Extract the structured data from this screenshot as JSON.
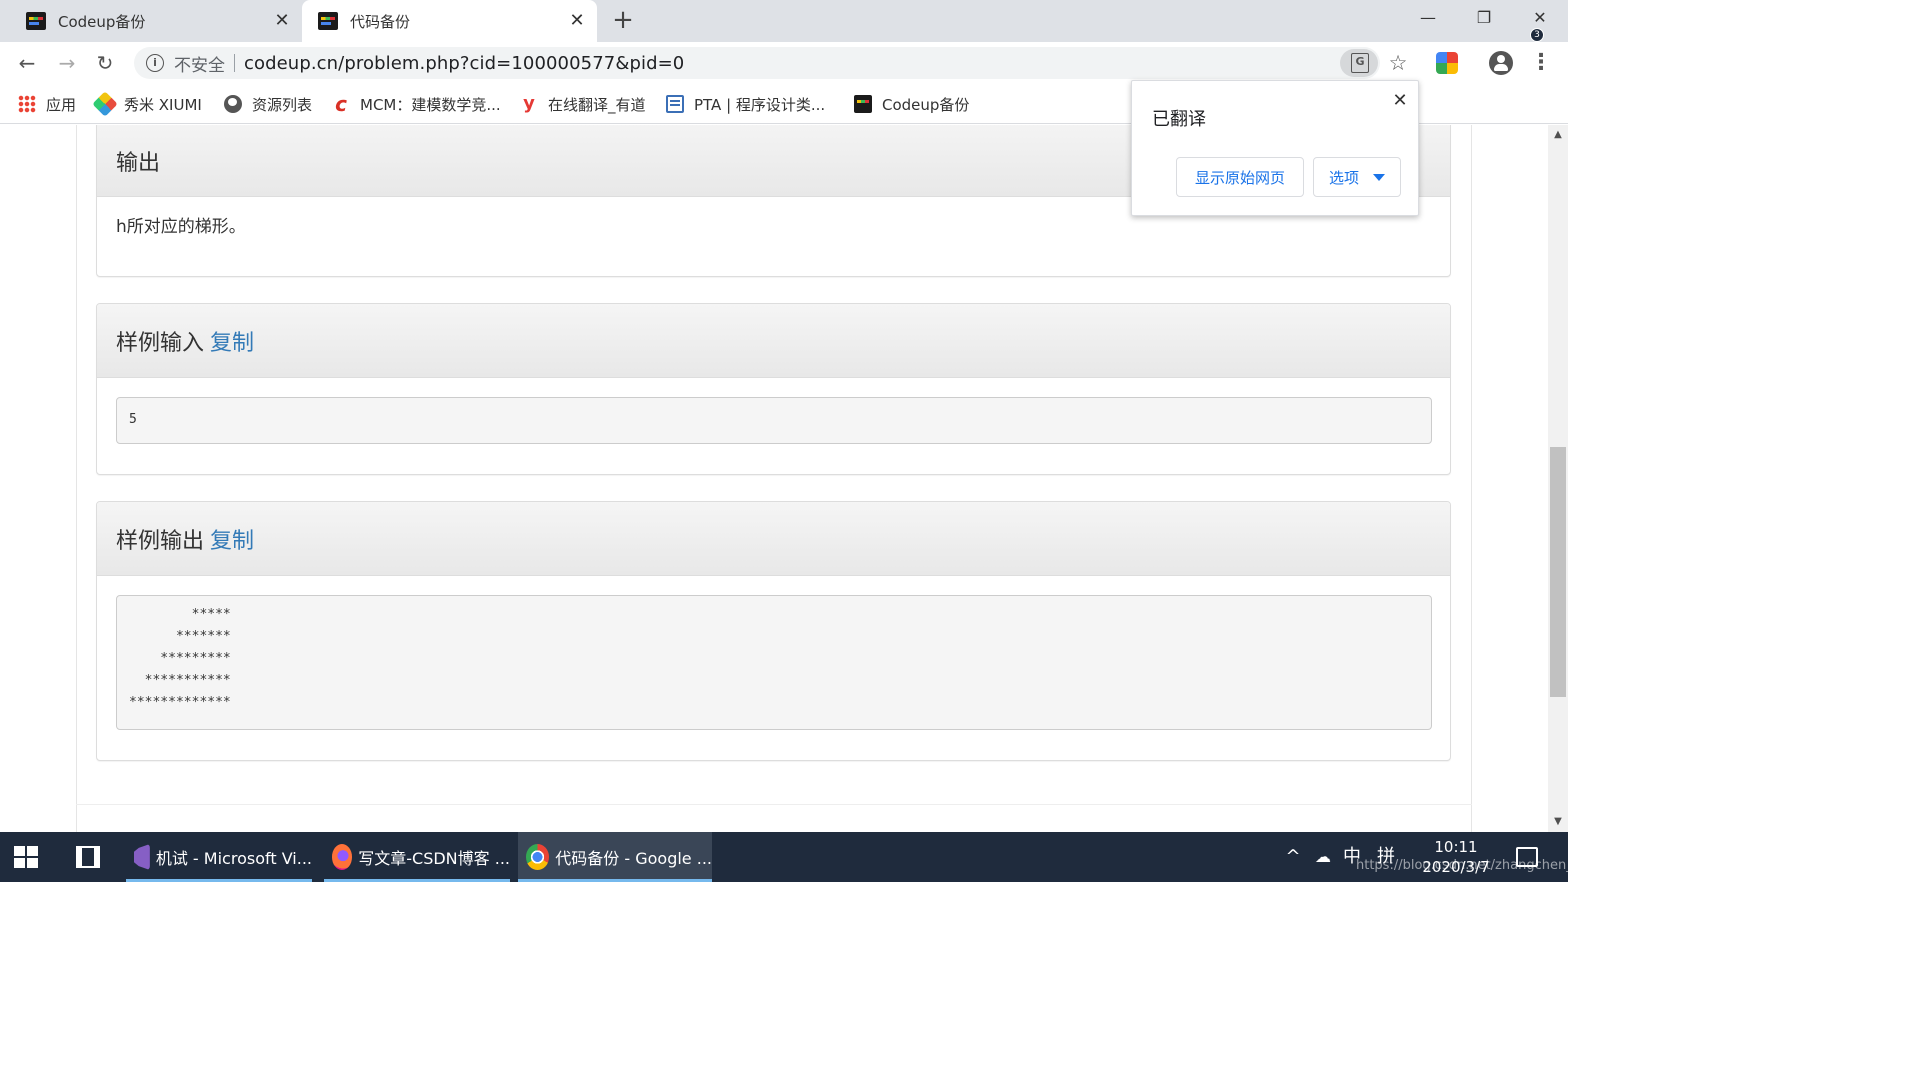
{
  "browser": {
    "tabs": [
      {
        "title": "Codeup备份",
        "close": "✕"
      },
      {
        "title": "代码备份",
        "close": "✕"
      }
    ],
    "new_tab": "+",
    "window_controls": {
      "minimize": "—",
      "restore": "❐",
      "close": "✕"
    },
    "nav": {
      "back": "←",
      "forward": "→",
      "reload": "↻"
    },
    "address": {
      "security_label": "不安全",
      "url": "codeup.cn/problem.php?cid=100000577&pid=0"
    },
    "bookmarks": [
      {
        "label": "应用",
        "icon": "apps-grid-icon"
      },
      {
        "label": "秀米 XIUMI",
        "icon": "xiumi-icon"
      },
      {
        "label": "资源列表",
        "icon": "globe-icon"
      },
      {
        "label": "MCM：建模数学竞...",
        "icon": "mcm-icon"
      },
      {
        "label": "在线翻译_有道",
        "icon": "youdao-icon"
      },
      {
        "label": "PTA | 程序设计类...",
        "icon": "pta-icon"
      },
      {
        "label": "Codeup备份",
        "icon": "codeup-icon"
      }
    ]
  },
  "translate_popup": {
    "title": "已翻译",
    "close": "✕",
    "show_original": "显示原始网页",
    "options": "选项"
  },
  "sections": {
    "output": {
      "heading": "输出",
      "body": "h所对应的梯形。"
    },
    "sample_input": {
      "heading": "样例输入",
      "copy": "复制",
      "content": "5"
    },
    "sample_output": {
      "heading": "样例输出",
      "copy": "复制",
      "content": "        *****\n      *******\n    *********\n  ***********\n*************"
    }
  },
  "scrollbar": {
    "up": "▲",
    "down": "▼"
  },
  "taskbar": {
    "items": [
      {
        "label": "机试 - Microsoft Vi...",
        "icon": "visual-studio-icon"
      },
      {
        "label": "写文章-CSDN博客 ...",
        "icon": "firefox-icon"
      },
      {
        "label": "代码备份 - Google ...",
        "icon": "chrome-icon"
      }
    ],
    "tray": {
      "chevron": "^",
      "ime": "中",
      "ime_mode": "拼"
    },
    "clock": {
      "time": "10:11",
      "date": "2020/3/7"
    },
    "notification_count": "3",
    "watermark": "https://blog.csdn.net/zhangchen_an"
  },
  "colors": {
    "link": "#337ab7",
    "translate_button_text": "#1a73e8",
    "taskbar_bg": "#1f2b3d",
    "tab_strip_bg": "#dee1e6"
  }
}
